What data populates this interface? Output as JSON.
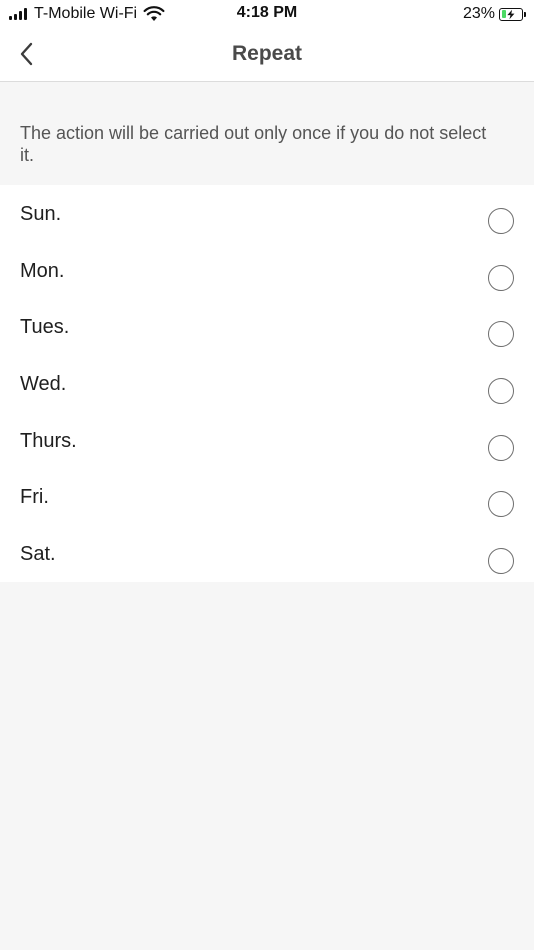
{
  "status_bar": {
    "carrier": "T-Mobile Wi-Fi",
    "time": "4:18 PM",
    "battery_percent": "23%",
    "battery_level": 0.23,
    "battery_color": "#4cd964",
    "signal_icon": "cellular-signal-icon",
    "wifi_icon": "wifi-icon",
    "battery_icon": "battery-charging-icon"
  },
  "nav": {
    "title": "Repeat",
    "back_icon": "chevron-left-icon"
  },
  "hint": {
    "text": "The action will be carried out only once if you do not select it."
  },
  "days": [
    {
      "label": "Sun.",
      "selected": false
    },
    {
      "label": "Mon.",
      "selected": false
    },
    {
      "label": "Tues.",
      "selected": false
    },
    {
      "label": "Wed.",
      "selected": false
    },
    {
      "label": "Thurs.",
      "selected": false
    },
    {
      "label": "Fri.",
      "selected": false
    },
    {
      "label": "Sat.",
      "selected": false
    }
  ]
}
